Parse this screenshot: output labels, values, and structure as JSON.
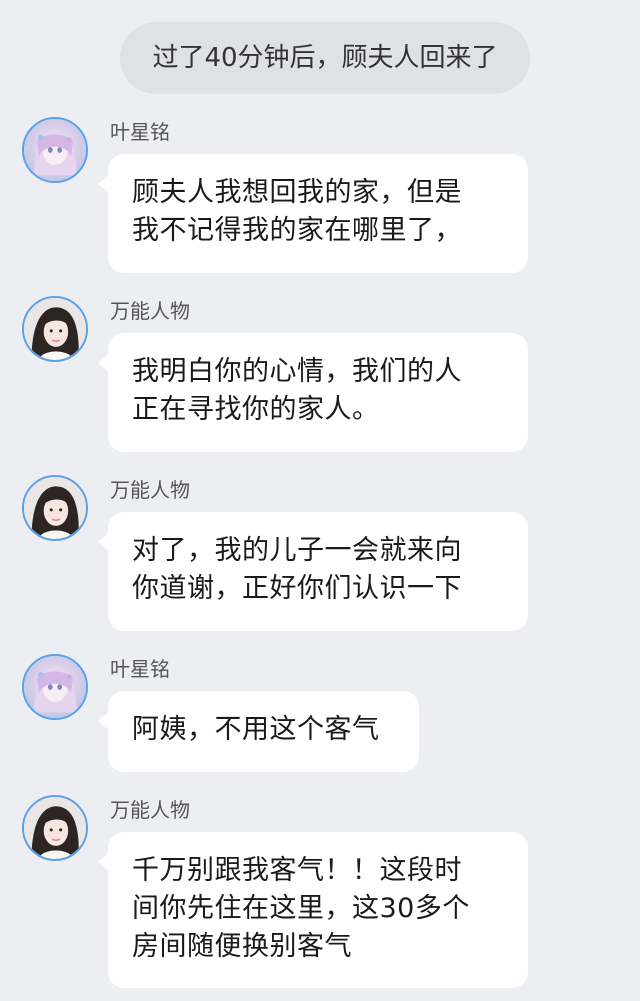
{
  "system_notice": "过了40分钟后，顾夫人回来了",
  "messages": [
    {
      "sender": "叶星铭",
      "avatar": "anime-girl-avatar",
      "lines": [
        "顾夫人我想回我的家，但是",
        "我不记得我的家在哪里了，"
      ]
    },
    {
      "sender": "万能人物",
      "avatar": "girl-photo-avatar",
      "lines": [
        "我明白你的心情，我们的人",
        "正在寻找你的家人。"
      ]
    },
    {
      "sender": "万能人物",
      "avatar": "girl-photo-avatar",
      "lines": [
        "对了，我的儿子一会就来向",
        "你道谢，正好你们认识一下"
      ]
    },
    {
      "sender": "叶星铭",
      "avatar": "anime-girl-avatar",
      "lines": [
        "阿姨，不用这个客气"
      ]
    },
    {
      "sender": "万能人物",
      "avatar": "girl-photo-avatar",
      "lines": [
        "千万别跟我客气！！这段时",
        "间你先住在这里，这30多个",
        "房间随便换别客气"
      ]
    }
  ],
  "colors": {
    "background": "#edeef2",
    "bubble": "#ffffff",
    "system_pill": "#dfe1e6",
    "avatar_ring": "#5aa0ea"
  }
}
